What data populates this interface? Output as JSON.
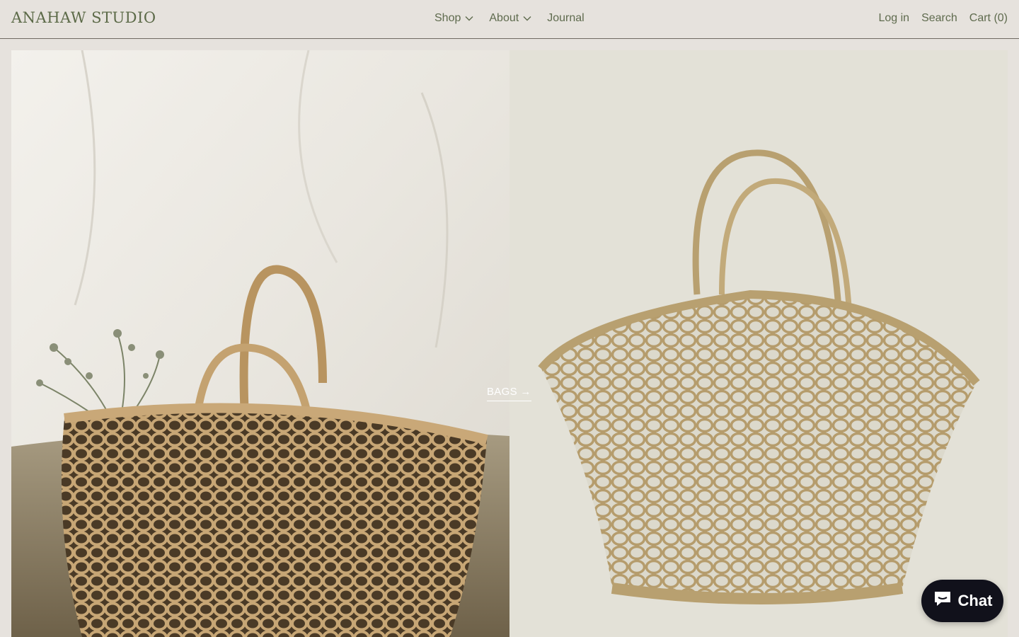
{
  "header": {
    "logo": "ANAHAW STUDIO",
    "nav": [
      {
        "label": "Shop"
      },
      {
        "label": "About"
      },
      {
        "label": "Journal"
      }
    ],
    "right": {
      "login": "Log in",
      "search": "Search",
      "cart": "Cart (0)"
    }
  },
  "hero": {
    "link_label": "BAGS →",
    "left_image": "woven basket bag with dried flowers on white drape",
    "right_image": "open-weave abaca tote bag on light background"
  },
  "chat": {
    "label": "Chat",
    "icon": "chat-bubble-icon"
  },
  "colors": {
    "background": "#e6e2dd",
    "accent_text": "#5f6b4e",
    "chat_button": "#11111b"
  }
}
